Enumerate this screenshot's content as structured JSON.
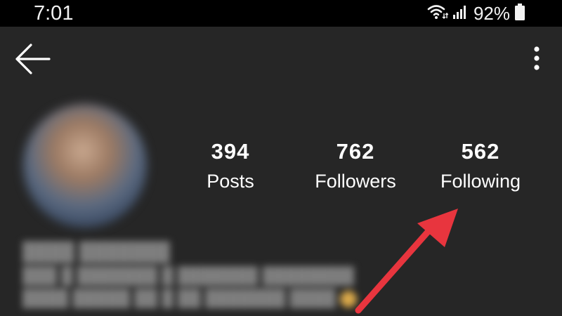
{
  "status_bar": {
    "time": "7:01",
    "battery": "92%",
    "icons": [
      "wifi-icon",
      "signal-icon",
      "battery-icon"
    ]
  },
  "app_bar": {
    "back_icon": "arrow-left-icon",
    "username": "",
    "more_icon": "more-vertical-icon"
  },
  "profile": {
    "stats": [
      {
        "value": "394",
        "label": "Posts"
      },
      {
        "value": "762",
        "label": "Followers"
      },
      {
        "value": "562",
        "label": "Following"
      }
    ]
  },
  "annotation": {
    "color": "#e8353e",
    "icon": "red-arrow-pointer"
  },
  "colors": {
    "background": "#262626",
    "status_bar": "#000000",
    "text": "#ffffff"
  }
}
